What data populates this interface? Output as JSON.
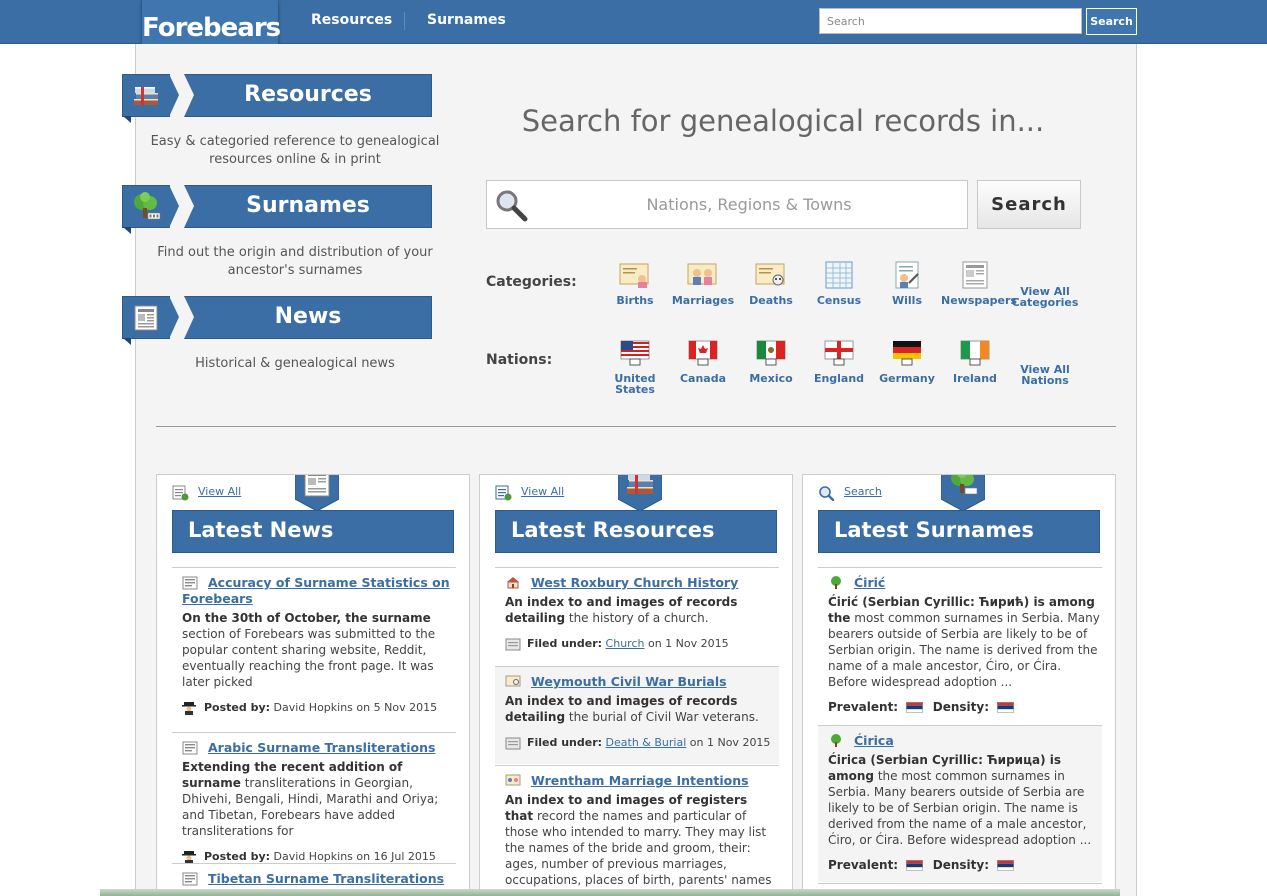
{
  "header": {
    "logo": "Forebears",
    "nav": [
      {
        "label": "Resources"
      },
      {
        "label": "Surnames"
      }
    ],
    "search_placeholder": "Search",
    "search_button": "Search"
  },
  "sidebar": {
    "sections": [
      {
        "title": "Resources",
        "icon": "books-icon",
        "description": "Easy & categoried reference to genealogical resources online & in print"
      },
      {
        "title": "Surnames",
        "icon": "tree-icon",
        "description": "Find out the origin and distribution of your ancestor's surnames"
      },
      {
        "title": "News",
        "icon": "newspaper-icon",
        "description": "Historical & genealogical news"
      }
    ]
  },
  "hero": {
    "title": "Search for genealogical records in...",
    "placeholder": "Nations, Regions & Towns",
    "button": "Search",
    "categories_label": "Categories:",
    "categories": [
      {
        "label": "Births",
        "icon": "birth-certificate-icon"
      },
      {
        "label": "Marriages",
        "icon": "marriage-certificate-icon"
      },
      {
        "label": "Deaths",
        "icon": "death-certificate-icon"
      },
      {
        "label": "Census",
        "icon": "census-sheet-icon"
      },
      {
        "label": "Wills",
        "icon": "will-document-icon"
      },
      {
        "label": "Newspapers",
        "icon": "newspaper-icon"
      }
    ],
    "categories_view_all": [
      "View All",
      "Categories"
    ],
    "nations_label": "Nations:",
    "nations": [
      {
        "line1": "United",
        "line2": "States",
        "code": "US"
      },
      {
        "line1": "Canada",
        "line2": "",
        "code": "CA"
      },
      {
        "line1": "Mexico",
        "line2": "",
        "code": "MX"
      },
      {
        "line1": "England",
        "line2": "",
        "code": "GB"
      },
      {
        "line1": "Germany",
        "line2": "",
        "code": "DE"
      },
      {
        "line1": "Ireland",
        "line2": "",
        "code": "IE"
      }
    ],
    "nations_view_all": [
      "View All",
      "Nations"
    ]
  },
  "cards": {
    "news": {
      "top_link": "View All",
      "title": "Latest News",
      "items": [
        {
          "title": "Accuracy of Surname Statistics on Forebears",
          "lead": "On the 30th of October, the surname",
          "body": "section of Forebears was submitted to the popular content sharing website, Reddit, eventually reaching the front page. It was later picked",
          "posted_label": "Posted by:",
          "posted_rest": "David Hopkins on 5 Nov 2015"
        },
        {
          "title": "Arabic Surname Transliterations",
          "lead": "Extending the recent addition of surname",
          "body": "transliterations in Georgian, Dhivehi, Bengali, Hindi, Marathi and Oriya; and Tibetan, Forebears have added transliterations for",
          "posted_label": "Posted by:",
          "posted_rest": "David Hopkins on 16 Jul 2015"
        },
        {
          "title": "Tibetan Surname Transliterations"
        }
      ]
    },
    "resources": {
      "top_link": "View All",
      "title": "Latest Resources",
      "items": [
        {
          "title": "West Roxbury Church History",
          "lead": "An index to and images of records detailing",
          "body": "the history of a church.",
          "filed_label": "Filed under:",
          "filed_link": "Church",
          "filed_date": "on 1 Nov 2015"
        },
        {
          "title": "Weymouth Civil War Burials",
          "lead": "An index to and images of records detailing",
          "body": "the burial of Civil War veterans.",
          "filed_label": "Filed under:",
          "filed_link": "Death & Burial",
          "filed_date": "on 1 Nov 2015"
        },
        {
          "title": "Wrentham Marriage Intentions",
          "lead": "An index to and images of registers that",
          "body": "record the names and particular of those who intended to marry. They may list the names of the bride and groom, their: ages, number of previous marriages, occupations, places of birth, parents' names and date the intention was"
        }
      ]
    },
    "surnames": {
      "top_link": "Search",
      "title": "Latest Surnames",
      "items": [
        {
          "title": "Ćirić",
          "lead": "Ćirić (Serbian Cyrillic: Ћирић) is among the",
          "body": "most common surnames in Serbia. Many bearers outside of Serbia are likely to be of Serbian origin. The name is derived from the name of a male ancestor, Ćiro, or Ćira. Before widespread adoption ...",
          "prevalent": "Prevalent:",
          "density": "Density:"
        },
        {
          "title": "Ćirica",
          "lead": "Ćirica (Serbian Cyrillic: Ћирица) is among",
          "body": "the most common surnames in Serbia. Many bearers outside of Serbia are likely to be of Serbian origin. The name is derived from the name of a male ancestor, Ćiro, or Ćira. Before widespread adoption ...",
          "prevalent": "Prevalent:",
          "density": "Density:"
        }
      ]
    }
  },
  "colors": {
    "brand_blue": "#3a6ea5",
    "link_blue": "#3a6ea5",
    "page_bg": "#f4f4f4"
  }
}
